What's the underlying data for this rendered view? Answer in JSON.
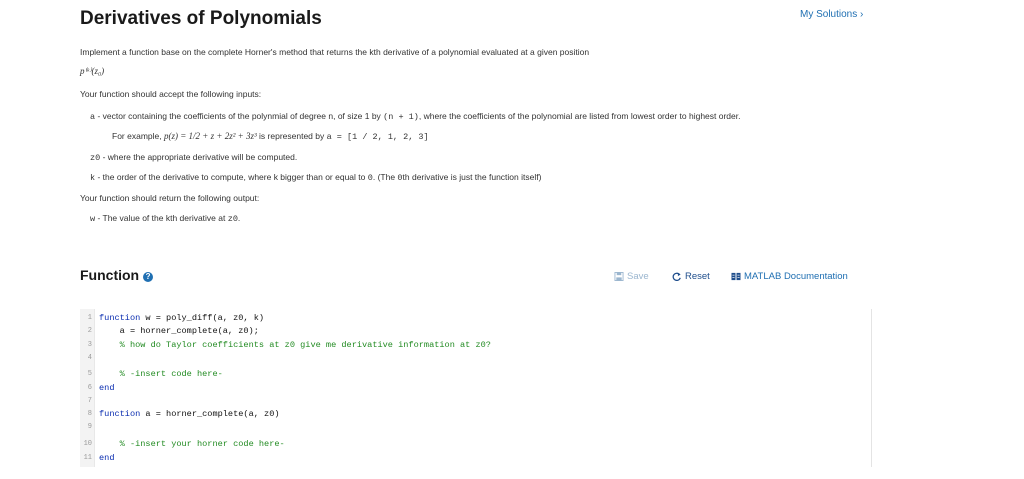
{
  "page": {
    "title": "Derivatives of Polynomials",
    "my_solutions": "My Solutions ›"
  },
  "description": {
    "intro": "Implement a function base on the complete Horner's method that returns the kth derivative of a polynomial evaluated at a given position",
    "formula": "p⁽ᵏ⁾(z₀)",
    "inputs_header": "Your function should accept the following inputs:",
    "input_a_var": "a",
    "input_a_text_1": " - vector containing the coefficients of the polynmial of degree n, of size 1 by ",
    "input_a_code": "(n + 1)",
    "input_a_text_2": ", where the coefficients of the polynomial are listed from lowest order to highest order.",
    "example_prefix": "For example, ",
    "example_math": "p(z) = 1/2 + z + 2z² + 3z³",
    "example_mid": " is represented by ",
    "example_code": "a = [1 / 2, 1, 2, 3]",
    "input_z0_var": "z0",
    "input_z0_text": " - where the appropriate derivative will be computed.",
    "input_k_var": "k",
    "input_k_text_1": " - the order of the derivative to compute, where k bigger than or equal to ",
    "input_k_code": "0",
    "input_k_text_2": ". (The ",
    "input_k_code_2": "0",
    "input_k_text_3": "th derivative is just the function itself)",
    "output_header": "Your function should return the following output:",
    "output_w_var": "w",
    "output_w_text": " - The value of the kth derivative at ",
    "output_w_code": "z0",
    "output_w_end": "."
  },
  "function_section": {
    "title": "Function",
    "save_label": "Save",
    "reset_label": "Reset",
    "doc_label": "MATLAB Documentation"
  },
  "editor": {
    "lines": [
      {
        "n": "1",
        "kw": "function",
        "rest": " w = poly_diff(a, z0, k)",
        "comment": ""
      },
      {
        "n": "2",
        "kw": "",
        "rest": "    a = horner_complete(a, z0);",
        "comment": ""
      },
      {
        "n": "3",
        "kw": "",
        "rest": "    ",
        "comment": "% how do Taylor coefficients at z0 give me derivative information at z0?"
      },
      {
        "n": "4",
        "kw": "",
        "rest": "",
        "comment": ""
      },
      {
        "n": "5",
        "kw": "",
        "rest": "    ",
        "comment": "% -insert code here-"
      },
      {
        "n": "6",
        "kw": "end",
        "rest": "",
        "comment": ""
      },
      {
        "n": "7",
        "kw": "",
        "rest": "",
        "comment": ""
      },
      {
        "n": "8",
        "kw": "function",
        "rest": " a = horner_complete(a, z0)",
        "comment": ""
      },
      {
        "n": "9",
        "kw": "",
        "rest": "",
        "comment": ""
      },
      {
        "n": "10",
        "kw": "",
        "rest": "    ",
        "comment": "% -insert your horner code here-"
      },
      {
        "n": "11",
        "kw": "end",
        "rest": "",
        "comment": ""
      }
    ]
  }
}
